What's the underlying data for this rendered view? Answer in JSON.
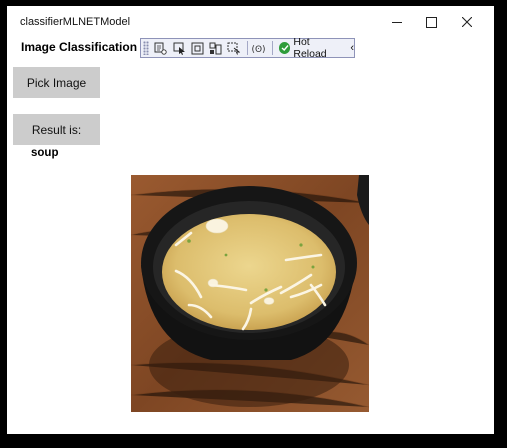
{
  "window": {
    "title": "classifierMLNETModel",
    "minimize_glyph": "—",
    "maximize_glyph": "☐",
    "close_glyph": "✕"
  },
  "app": {
    "heading": "Image Classification",
    "pick_button_label": "Pick Image",
    "result_label": "Result is:",
    "result_value": "soup"
  },
  "devbar": {
    "hot_reload_label": "Hot Reload",
    "collapse_glyph": "‹",
    "icons": [
      "live-visual-tree-icon",
      "select-element-icon",
      "display-layout-adorners-icon",
      "track-focus-icon",
      "binding-failures-icon",
      "in-app-toolbar-icon"
    ]
  },
  "image": {
    "subject": "bowl-of-miso-soup"
  },
  "colors": {
    "button_bg": "#cccccc",
    "devbar_bg": "#eef0f8",
    "devbar_border": "#8e93b8",
    "check_green": "#2e9c3a",
    "table_wood": "#8a4f2a",
    "bowl": "#111111",
    "broth": "#e4c97c"
  }
}
